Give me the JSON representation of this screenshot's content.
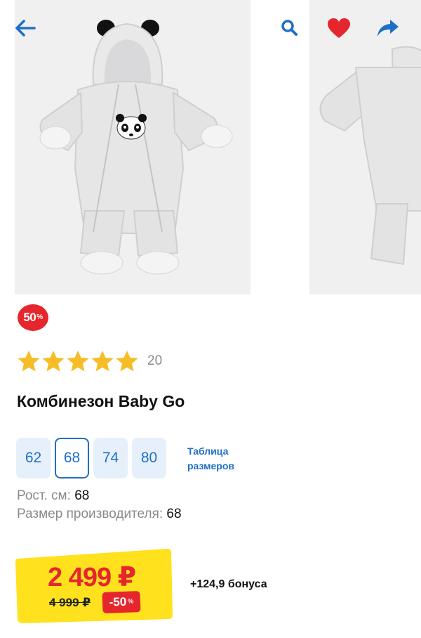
{
  "header": {
    "back_icon": "arrow-left-icon",
    "search_icon": "search-icon",
    "favorite_icon": "heart-icon",
    "share_icon": "share-arrow-icon",
    "accent_color": "#1f6fc5",
    "favorite_color": "#e6262d"
  },
  "product": {
    "discount_badge": "50",
    "discount_badge_suffix": "%",
    "rating": 5,
    "rating_max": 5,
    "review_count": "20",
    "title": "Комбинезон Baby Go"
  },
  "sizes": {
    "options": [
      "62",
      "68",
      "74",
      "80"
    ],
    "selected": "68",
    "table_link": "Таблица размеров"
  },
  "specs": {
    "height_label": "Рост. см:",
    "height_value": "68",
    "maker_size_label": "Размер производителя:",
    "maker_size_value": "68"
  },
  "price": {
    "current": "2 499 ₽",
    "old": "4 999 ₽",
    "discount": "-50",
    "discount_suffix": "%",
    "bonus": "+124,9 бонуса",
    "price_color": "#e6262d",
    "highlight_color": "#ffe11e"
  }
}
